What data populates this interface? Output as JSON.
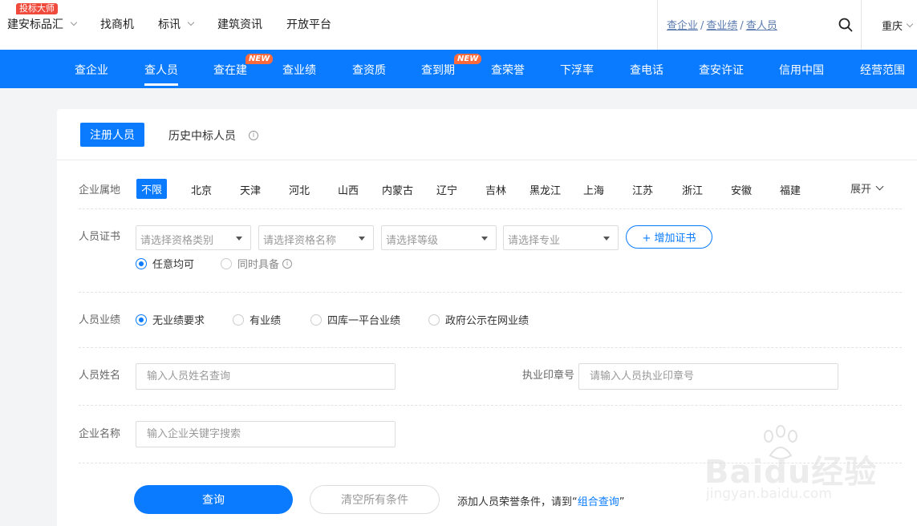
{
  "header": {
    "promo_badge": "投标大师",
    "brand": "建安标品汇",
    "nav": [
      "找商机",
      "标讯",
      "建筑资讯",
      "开放平台"
    ],
    "search_links": [
      "查企业",
      "查业绩",
      "查人员"
    ],
    "search_sep": "/",
    "city": "重庆"
  },
  "bluenav": {
    "items": [
      "查企业",
      "查人员",
      "查在建",
      "查业绩",
      "查资质",
      "查到期",
      "查荣誉",
      "下浮率",
      "查电话",
      "查安许证",
      "信用中国",
      "经营范围"
    ],
    "active_index": 1,
    "new_tag": "NEW",
    "accent": "#0a7bff"
  },
  "tabs": {
    "active": "注册人员",
    "other": "历史中标人员",
    "info_glyph": "i"
  },
  "filters": {
    "region_label": "企业属地",
    "regions": [
      "不限",
      "北京",
      "天津",
      "河北",
      "山西",
      "内蒙古",
      "辽宁",
      "吉林",
      "黑龙江",
      "上海",
      "江苏",
      "浙江",
      "安徽",
      "福建"
    ],
    "expand": "展开",
    "cert_label": "人员证书",
    "cert_selects": [
      "请选择资格类别",
      "请选择资格名称",
      "请选择等级",
      "请选择专业"
    ],
    "add_cert": "+ 增加证书",
    "cert_mode": [
      "任意均可",
      "同时具备"
    ],
    "perf_label": "人员业绩",
    "perf_options": [
      "无业绩要求",
      "有业绩",
      "四库一平台业绩",
      "政府公示在网业绩"
    ],
    "name_label": "人员姓名",
    "name_placeholder": "输入人员姓名查询",
    "seal_label": "执业印章号",
    "seal_placeholder": "请输入人员执业印章号",
    "company_label": "企业名称",
    "company_placeholder": "输入企业关键字搜索"
  },
  "actions": {
    "query": "查询",
    "clear": "清空所有条件",
    "hint_prefix": "添加人员荣誉条件，请到“",
    "hint_link": "组合查询",
    "hint_suffix": "”"
  },
  "watermark": {
    "text": "Baidu经验",
    "sub": "jingyan.baidu.com"
  }
}
